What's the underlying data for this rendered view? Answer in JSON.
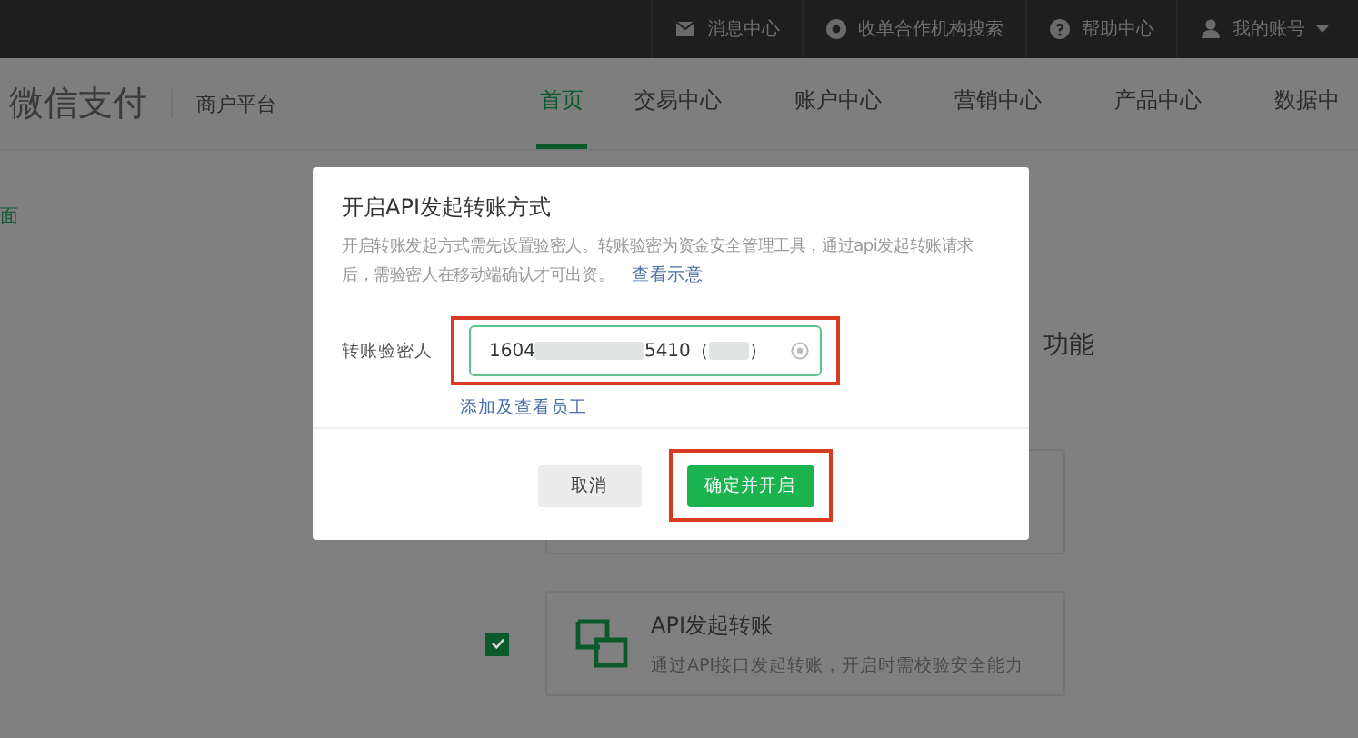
{
  "top_bar": {
    "items": [
      {
        "kind": "mail",
        "label": "消息中心"
      },
      {
        "kind": "target",
        "label": "收单合作机构搜索"
      },
      {
        "kind": "help",
        "label": "帮助中心"
      },
      {
        "kind": "user",
        "label": "我的账号",
        "dropdown": true
      }
    ]
  },
  "header": {
    "logo": "微信支付",
    "subtitle": "商户平台",
    "nav": [
      {
        "label": "首页",
        "selected": true
      },
      {
        "label": "交易中心",
        "selected": false
      },
      {
        "label": "账户中心",
        "selected": false
      },
      {
        "label": "营销中心",
        "selected": false
      },
      {
        "label": "产品中心",
        "selected": false
      },
      {
        "label": "数据中",
        "selected": false
      }
    ]
  },
  "sidebar": {
    "items": [
      {
        "label": "面",
        "selected": true
      }
    ]
  },
  "content": {
    "heading": "功能",
    "cards": [
      {
        "title": "API发起转账",
        "description": "通过API接口发起转账，开启时需校验安全能力",
        "checked": true
      }
    ]
  },
  "dialog": {
    "title": "开启API发起转账方式",
    "description": "开启转账发起方式需先设置验密人。转账验密为资金安全管理工具，通过api发起转账请求后，需验密人在移动端确认才可出资。",
    "description_link": "查看示意",
    "field": {
      "label": "转账验密人",
      "value_parts": [
        "1604",
        "5410（",
        "）"
      ],
      "highlighted": true
    },
    "field_link": "添加及查看员工",
    "buttons": [
      {
        "label": "取消",
        "kind": "secondary",
        "highlighted": false
      },
      {
        "label": "确定并开启",
        "kind": "primary",
        "highlighted": true
      }
    ]
  }
}
